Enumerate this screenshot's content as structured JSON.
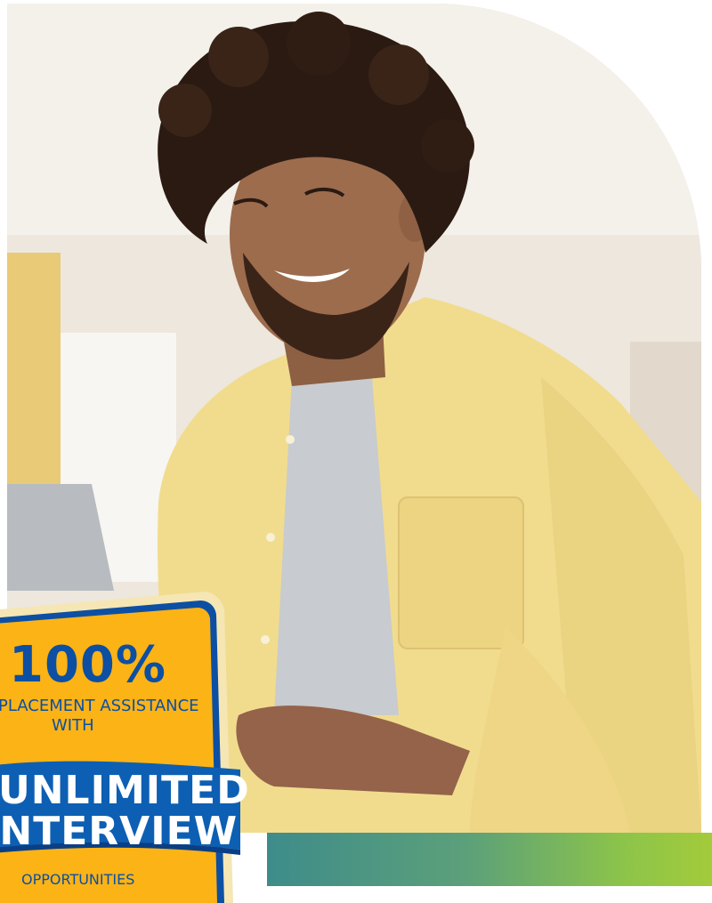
{
  "image": {
    "subject": "smiling young man with curly hair wearing yellow shirt using a laptop",
    "colors": {
      "shirt": "#f2dc8c",
      "tshirt": "#c9ccd0",
      "skin": "#9a6a4c",
      "hair": "#2a1a12",
      "wall": "#ece6dc",
      "window_curtain": "#e8c766"
    }
  },
  "badge": {
    "percent": "100%",
    "line1": "PLACEMENT ASSISTANCE",
    "line2": "WITH",
    "highlight1": "UNLIMITED",
    "highlight2": "INTERVIEW",
    "line3": "OPPORTUNITIES",
    "colors": {
      "fill": "#fbb316",
      "outer": "#f5e6b4",
      "border": "#0d4fa3",
      "ribbon": "#0d5fb3",
      "text": "#0d4fa3"
    }
  },
  "band": {
    "colors": [
      "#3e8c8a",
      "#8cc44a",
      "#a3cb3b"
    ]
  }
}
